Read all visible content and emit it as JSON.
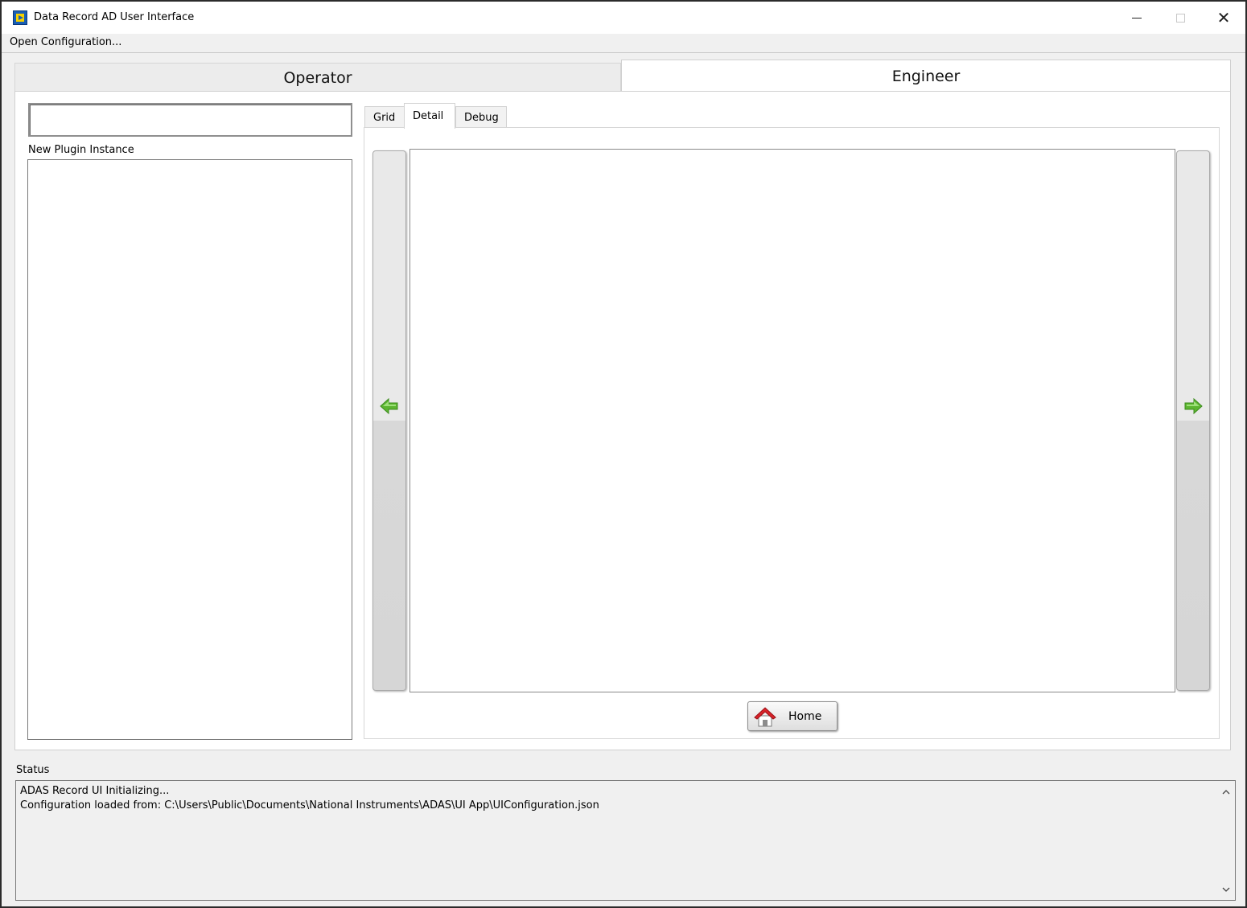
{
  "window": {
    "title": "Data Record AD User Interface"
  },
  "menu": {
    "open_configuration": "Open Configuration..."
  },
  "main_tabs": [
    {
      "label": "Operator",
      "selected": false
    },
    {
      "label": "Engineer",
      "selected": true
    }
  ],
  "plugin": {
    "input_value": "",
    "label": "New Plugin Instance",
    "items": []
  },
  "sub_tabs": [
    {
      "label": "Grid",
      "selected": false
    },
    {
      "label": "Detail",
      "selected": true
    },
    {
      "label": "Debug",
      "selected": false
    }
  ],
  "navigation": {
    "prev_icon": "green-left-arrow-icon",
    "next_icon": "green-right-arrow-icon",
    "home_label": "Home",
    "home_icon": "house-icon"
  },
  "status": {
    "label": "Status",
    "lines": [
      "ADAS Record UI Initializing...",
      "Configuration loaded from: C:\\Users\\Public\\Documents\\National Instruments\\ADAS\\UI App\\UIConfiguration.json"
    ]
  },
  "colors": {
    "arrow_green": "#5cb531",
    "home_red": "#d8232a"
  }
}
